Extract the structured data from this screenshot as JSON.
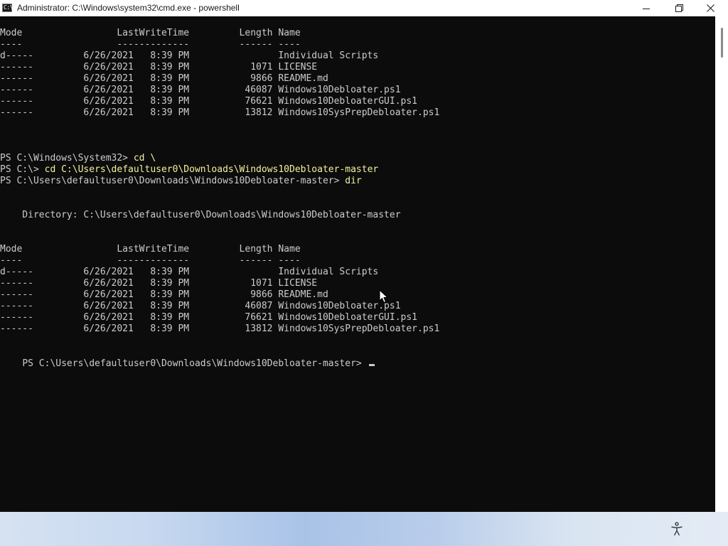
{
  "window": {
    "title": "Administrator: C:\\Windows\\system32\\cmd.exe - powershell",
    "app_icon_glyph": "C:\\",
    "icons": {
      "app": "console-app-icon",
      "minimize": "minimize-icon",
      "maximize": "maximize-icon",
      "close": "close-icon"
    }
  },
  "console": {
    "lines": [
      "Mode                 LastWriteTime         Length Name",
      "----                 -------------         ------ ----",
      "d-----         6/26/2021   8:39 PM                Individual Scripts",
      "------         6/26/2021   8:39 PM           1071 LICENSE",
      "------         6/26/2021   8:39 PM           9866 README.md",
      "------         6/26/2021   8:39 PM          46087 Windows10Debloater.ps1",
      "------         6/26/2021   8:39 PM          76621 Windows10DebloaterGUI.ps1",
      "------         6/26/2021   8:39 PM          13812 Windows10SysPrepDebloater.ps1",
      "",
      "",
      "",
      "PS C:\\Windows\\System32> cd \\",
      "PS C:\\> cd C:\\Users\\defaultuser0\\Downloads\\Windows10Debloater-master",
      "PS C:\\Users\\defaultuser0\\Downloads\\Windows10Debloater-master> dir",
      "",
      "",
      "    Directory: C:\\Users\\defaultuser0\\Downloads\\Windows10Debloater-master",
      "",
      "",
      "Mode                 LastWriteTime         Length Name",
      "----                 -------------         ------ ----",
      "d-----         6/26/2021   8:39 PM                Individual Scripts",
      "------         6/26/2021   8:39 PM           1071 LICENSE",
      "------         6/26/2021   8:39 PM           9866 README.md",
      "------         6/26/2021   8:39 PM          46087 Windows10Debloater.ps1",
      "------         6/26/2021   8:39 PM          76621 Windows10DebloaterGUI.ps1",
      "------         6/26/2021   8:39 PM          13812 Windows10SysPrepDebloater.ps1"
    ],
    "prompt": "PS C:\\Users\\defaultuser0\\Downloads\\Windows10Debloater-master>",
    "input_value": "",
    "colors": {
      "background": "#0c0c0c",
      "foreground": "#cccccc",
      "command_highlight": "#f2f2a0"
    }
  },
  "desktop": {
    "accessibility_icon": "accessibility-icon"
  },
  "cursor": {
    "icon": "mouse-pointer-icon"
  }
}
